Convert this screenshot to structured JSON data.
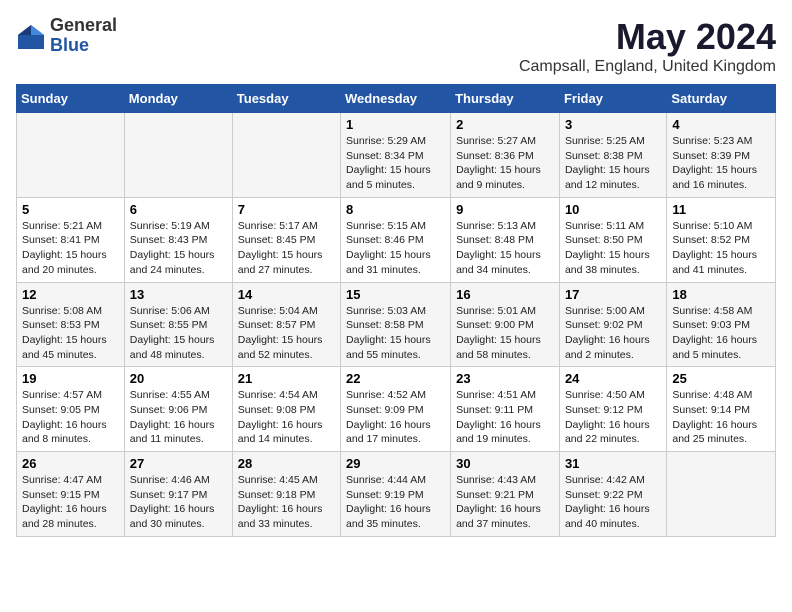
{
  "logo": {
    "general": "General",
    "blue": "Blue"
  },
  "title": "May 2024",
  "location": "Campsall, England, United Kingdom",
  "weekdays": [
    "Sunday",
    "Monday",
    "Tuesday",
    "Wednesday",
    "Thursday",
    "Friday",
    "Saturday"
  ],
  "weeks": [
    [
      {
        "day": "",
        "sunrise": "",
        "sunset": "",
        "daylight": ""
      },
      {
        "day": "",
        "sunrise": "",
        "sunset": "",
        "daylight": ""
      },
      {
        "day": "",
        "sunrise": "",
        "sunset": "",
        "daylight": ""
      },
      {
        "day": "1",
        "sunrise": "Sunrise: 5:29 AM",
        "sunset": "Sunset: 8:34 PM",
        "daylight": "Daylight: 15 hours and 5 minutes."
      },
      {
        "day": "2",
        "sunrise": "Sunrise: 5:27 AM",
        "sunset": "Sunset: 8:36 PM",
        "daylight": "Daylight: 15 hours and 9 minutes."
      },
      {
        "day": "3",
        "sunrise": "Sunrise: 5:25 AM",
        "sunset": "Sunset: 8:38 PM",
        "daylight": "Daylight: 15 hours and 12 minutes."
      },
      {
        "day": "4",
        "sunrise": "Sunrise: 5:23 AM",
        "sunset": "Sunset: 8:39 PM",
        "daylight": "Daylight: 15 hours and 16 minutes."
      }
    ],
    [
      {
        "day": "5",
        "sunrise": "Sunrise: 5:21 AM",
        "sunset": "Sunset: 8:41 PM",
        "daylight": "Daylight: 15 hours and 20 minutes."
      },
      {
        "day": "6",
        "sunrise": "Sunrise: 5:19 AM",
        "sunset": "Sunset: 8:43 PM",
        "daylight": "Daylight: 15 hours and 24 minutes."
      },
      {
        "day": "7",
        "sunrise": "Sunrise: 5:17 AM",
        "sunset": "Sunset: 8:45 PM",
        "daylight": "Daylight: 15 hours and 27 minutes."
      },
      {
        "day": "8",
        "sunrise": "Sunrise: 5:15 AM",
        "sunset": "Sunset: 8:46 PM",
        "daylight": "Daylight: 15 hours and 31 minutes."
      },
      {
        "day": "9",
        "sunrise": "Sunrise: 5:13 AM",
        "sunset": "Sunset: 8:48 PM",
        "daylight": "Daylight: 15 hours and 34 minutes."
      },
      {
        "day": "10",
        "sunrise": "Sunrise: 5:11 AM",
        "sunset": "Sunset: 8:50 PM",
        "daylight": "Daylight: 15 hours and 38 minutes."
      },
      {
        "day": "11",
        "sunrise": "Sunrise: 5:10 AM",
        "sunset": "Sunset: 8:52 PM",
        "daylight": "Daylight: 15 hours and 41 minutes."
      }
    ],
    [
      {
        "day": "12",
        "sunrise": "Sunrise: 5:08 AM",
        "sunset": "Sunset: 8:53 PM",
        "daylight": "Daylight: 15 hours and 45 minutes."
      },
      {
        "day": "13",
        "sunrise": "Sunrise: 5:06 AM",
        "sunset": "Sunset: 8:55 PM",
        "daylight": "Daylight: 15 hours and 48 minutes."
      },
      {
        "day": "14",
        "sunrise": "Sunrise: 5:04 AM",
        "sunset": "Sunset: 8:57 PM",
        "daylight": "Daylight: 15 hours and 52 minutes."
      },
      {
        "day": "15",
        "sunrise": "Sunrise: 5:03 AM",
        "sunset": "Sunset: 8:58 PM",
        "daylight": "Daylight: 15 hours and 55 minutes."
      },
      {
        "day": "16",
        "sunrise": "Sunrise: 5:01 AM",
        "sunset": "Sunset: 9:00 PM",
        "daylight": "Daylight: 15 hours and 58 minutes."
      },
      {
        "day": "17",
        "sunrise": "Sunrise: 5:00 AM",
        "sunset": "Sunset: 9:02 PM",
        "daylight": "Daylight: 16 hours and 2 minutes."
      },
      {
        "day": "18",
        "sunrise": "Sunrise: 4:58 AM",
        "sunset": "Sunset: 9:03 PM",
        "daylight": "Daylight: 16 hours and 5 minutes."
      }
    ],
    [
      {
        "day": "19",
        "sunrise": "Sunrise: 4:57 AM",
        "sunset": "Sunset: 9:05 PM",
        "daylight": "Daylight: 16 hours and 8 minutes."
      },
      {
        "day": "20",
        "sunrise": "Sunrise: 4:55 AM",
        "sunset": "Sunset: 9:06 PM",
        "daylight": "Daylight: 16 hours and 11 minutes."
      },
      {
        "day": "21",
        "sunrise": "Sunrise: 4:54 AM",
        "sunset": "Sunset: 9:08 PM",
        "daylight": "Daylight: 16 hours and 14 minutes."
      },
      {
        "day": "22",
        "sunrise": "Sunrise: 4:52 AM",
        "sunset": "Sunset: 9:09 PM",
        "daylight": "Daylight: 16 hours and 17 minutes."
      },
      {
        "day": "23",
        "sunrise": "Sunrise: 4:51 AM",
        "sunset": "Sunset: 9:11 PM",
        "daylight": "Daylight: 16 hours and 19 minutes."
      },
      {
        "day": "24",
        "sunrise": "Sunrise: 4:50 AM",
        "sunset": "Sunset: 9:12 PM",
        "daylight": "Daylight: 16 hours and 22 minutes."
      },
      {
        "day": "25",
        "sunrise": "Sunrise: 4:48 AM",
        "sunset": "Sunset: 9:14 PM",
        "daylight": "Daylight: 16 hours and 25 minutes."
      }
    ],
    [
      {
        "day": "26",
        "sunrise": "Sunrise: 4:47 AM",
        "sunset": "Sunset: 9:15 PM",
        "daylight": "Daylight: 16 hours and 28 minutes."
      },
      {
        "day": "27",
        "sunrise": "Sunrise: 4:46 AM",
        "sunset": "Sunset: 9:17 PM",
        "daylight": "Daylight: 16 hours and 30 minutes."
      },
      {
        "day": "28",
        "sunrise": "Sunrise: 4:45 AM",
        "sunset": "Sunset: 9:18 PM",
        "daylight": "Daylight: 16 hours and 33 minutes."
      },
      {
        "day": "29",
        "sunrise": "Sunrise: 4:44 AM",
        "sunset": "Sunset: 9:19 PM",
        "daylight": "Daylight: 16 hours and 35 minutes."
      },
      {
        "day": "30",
        "sunrise": "Sunrise: 4:43 AM",
        "sunset": "Sunset: 9:21 PM",
        "daylight": "Daylight: 16 hours and 37 minutes."
      },
      {
        "day": "31",
        "sunrise": "Sunrise: 4:42 AM",
        "sunset": "Sunset: 9:22 PM",
        "daylight": "Daylight: 16 hours and 40 minutes."
      },
      {
        "day": "",
        "sunrise": "",
        "sunset": "",
        "daylight": ""
      }
    ]
  ]
}
